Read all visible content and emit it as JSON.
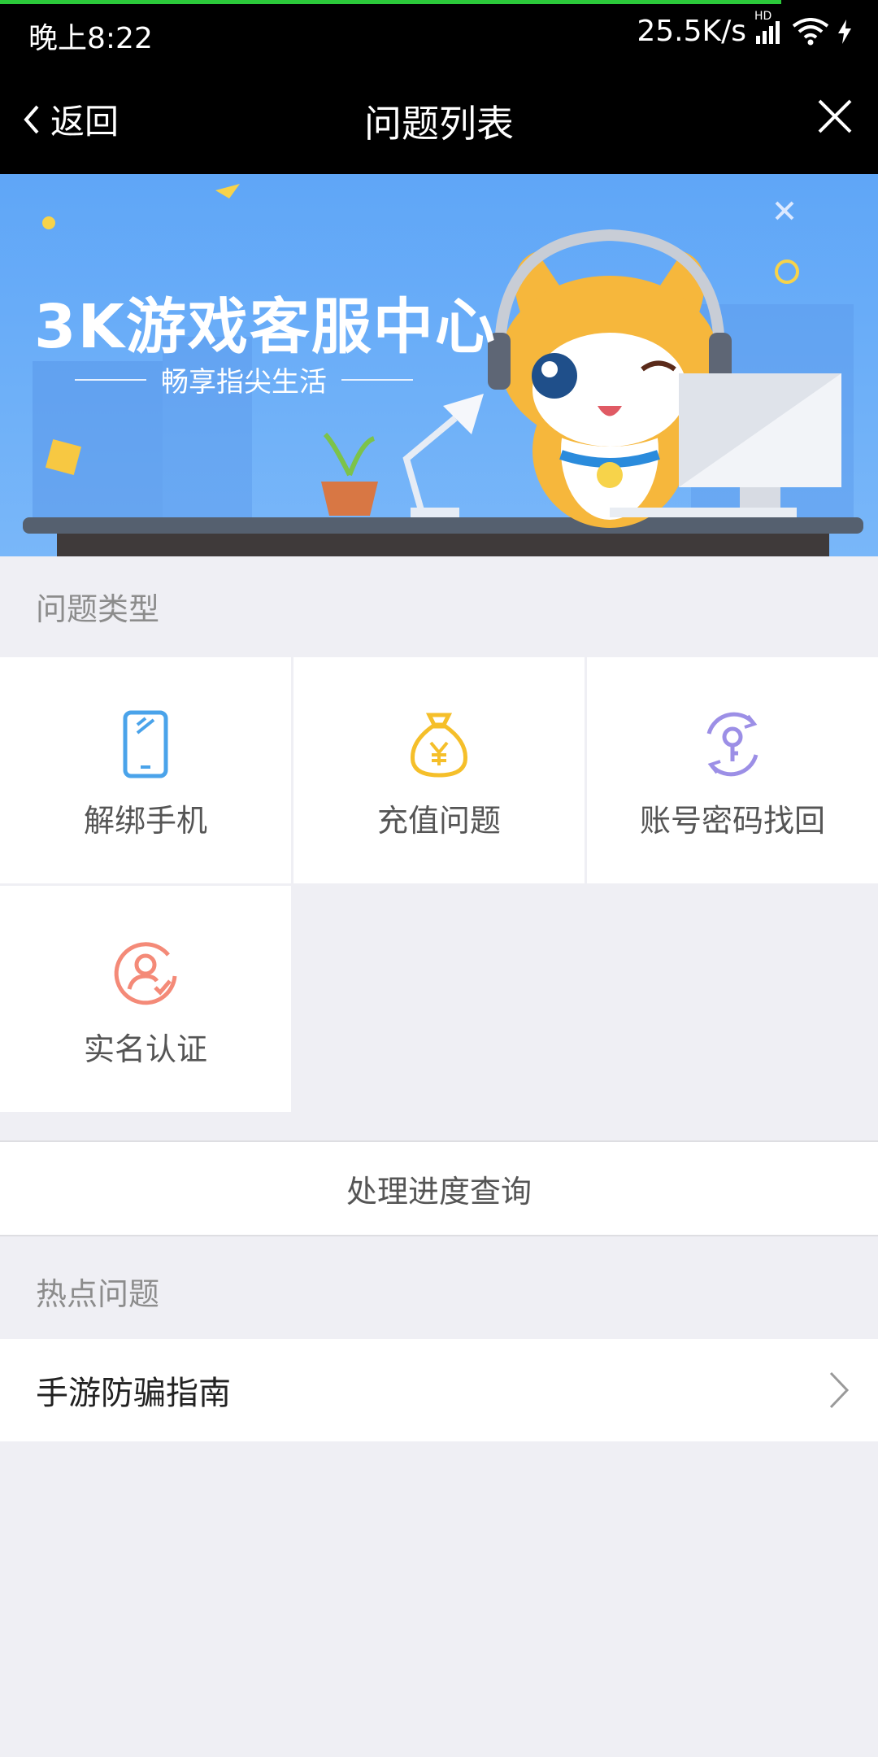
{
  "status_bar": {
    "time": "晚上8:22",
    "network_speed": "25.5K/s",
    "signal_label": "HD",
    "page_load_progress": 0.89
  },
  "nav": {
    "back_label": "返回",
    "title": "问题列表",
    "close_icon": "close-icon"
  },
  "banner": {
    "title": "3K游戏客服中心",
    "subtitle": "畅享指尖生活"
  },
  "categories": {
    "header": "问题类型",
    "items": [
      {
        "label": "解绑手机",
        "icon": "phone-icon",
        "color": "#4aa3ea"
      },
      {
        "label": "充值问题",
        "icon": "money-bag-icon",
        "color": "#f5bf2a"
      },
      {
        "label": "账号密码找回",
        "icon": "key-refresh-icon",
        "color": "#9c8fe6"
      },
      {
        "label": "实名认证",
        "icon": "user-check-icon",
        "color": "#f48a78"
      }
    ]
  },
  "progress_query": {
    "label": "处理进度查询"
  },
  "hot": {
    "header": "热点问题",
    "items": [
      {
        "label": "手游防骗指南"
      }
    ]
  },
  "colors": {
    "top_bar": "#000000",
    "progress": "#2bc93a",
    "banner_blue": "#5fa6f7",
    "page_bg": "#efeff4"
  }
}
